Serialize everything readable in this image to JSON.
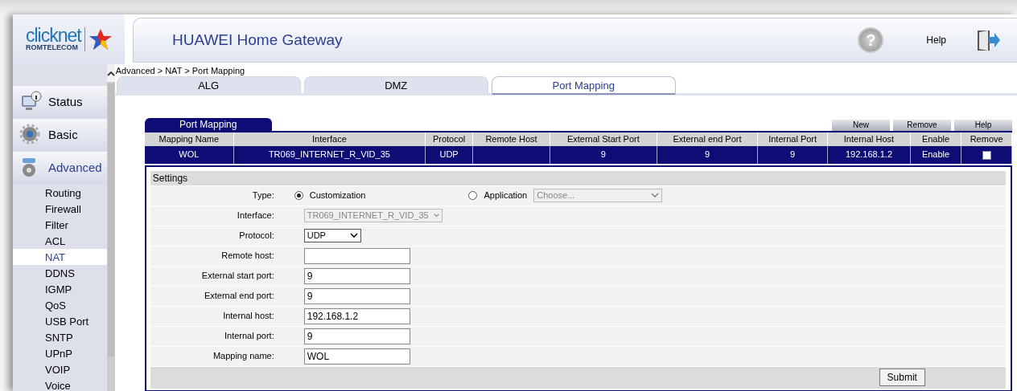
{
  "logo": {
    "brand": "clicknet",
    "sub": "ROMTELECOM"
  },
  "header": {
    "title": "HUAWEI Home Gateway",
    "help_glyph": "?",
    "help_label": "Help"
  },
  "sidebar": {
    "items": [
      {
        "label": "Status",
        "kind": "status",
        "expanded": false
      },
      {
        "label": "Basic",
        "kind": "basic",
        "expanded": false
      },
      {
        "label": "Advanced",
        "kind": "advanced",
        "expanded": true,
        "children": [
          {
            "label": "Routing",
            "selected": false
          },
          {
            "label": "Firewall",
            "selected": false
          },
          {
            "label": "Filter",
            "selected": false
          },
          {
            "label": "ACL",
            "selected": false
          },
          {
            "label": "NAT",
            "selected": true
          },
          {
            "label": "DDNS",
            "selected": false
          },
          {
            "label": "IGMP",
            "selected": false
          },
          {
            "label": "QoS",
            "selected": false
          },
          {
            "label": "USB Port",
            "selected": false
          },
          {
            "label": "SNTP",
            "selected": false
          },
          {
            "label": "UPnP",
            "selected": false
          },
          {
            "label": "VOIP",
            "selected": false
          },
          {
            "label": "Voice",
            "selected": false
          }
        ]
      }
    ]
  },
  "breadcrumb": "Advanced > NAT > Port Mapping",
  "tabs": [
    {
      "label": "ALG",
      "selected": false
    },
    {
      "label": "DMZ",
      "selected": false
    },
    {
      "label": "Port Mapping",
      "selected": true
    }
  ],
  "panel": {
    "tab_label": "Port Mapping",
    "buttons": [
      "New",
      "Remove",
      "Help"
    ],
    "table": {
      "columns": [
        "Mapping Name",
        "Interface",
        "Protocol",
        "Remote Host",
        "External Start Port",
        "External end Port",
        "Internal Port",
        "Internal Host",
        "Enable",
        "Remove"
      ],
      "rows": [
        {
          "selected": true,
          "cells": [
            "WOL",
            "TR069_INTERNET_R_VID_35",
            "UDP",
            null,
            "9",
            "9",
            "9",
            "192.168.1.2",
            "Enable"
          ],
          "remove_checked": false
        }
      ]
    }
  },
  "settings": {
    "title": "Settings",
    "type_label": "Type:",
    "type_options": [
      {
        "label": "Customization",
        "selected": true
      },
      {
        "label": "Application",
        "selected": false,
        "select_value": "Choose...",
        "select_disabled": true
      }
    ],
    "fields": [
      {
        "label": "Interface:",
        "kind": "select",
        "value": "TR069_INTERNET_R_VID_35",
        "disabled": true
      },
      {
        "label": "Protocol:",
        "kind": "select",
        "value": "UDP",
        "disabled": false
      },
      {
        "label": "Remote host:",
        "kind": "text"
      },
      {
        "label": "External start port:",
        "kind": "text",
        "value": "9"
      },
      {
        "label": "External end port:",
        "kind": "text",
        "value": "9"
      },
      {
        "label": "Internal host:",
        "kind": "text",
        "value": "192.168.1.2"
      },
      {
        "label": "Internal port:",
        "kind": "text",
        "value": "9"
      },
      {
        "label": "Mapping name:",
        "kind": "text",
        "value": "WOL"
      }
    ],
    "submit": "Submit"
  }
}
